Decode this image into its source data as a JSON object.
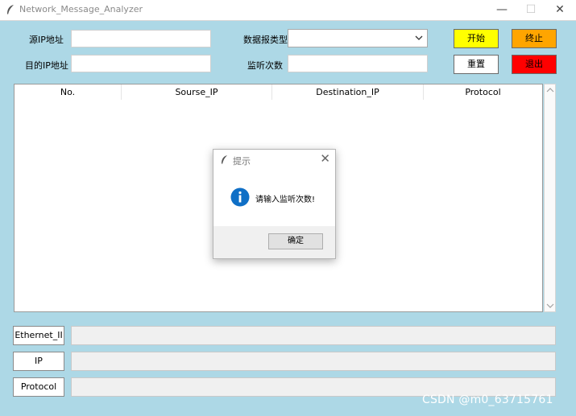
{
  "window": {
    "title": "Network_Message_Analyzer",
    "minimize_glyph": "—",
    "maximize_glyph": "☐",
    "close_glyph": "✕"
  },
  "form": {
    "src_ip_label": "源IP地址",
    "dst_ip_label": "目的IP地址",
    "packet_type_label": "数据报类型",
    "listen_count_label": "监听次数",
    "src_ip_value": "",
    "dst_ip_value": "",
    "packet_type_value": "",
    "listen_count_value": ""
  },
  "buttons": {
    "start": "开始",
    "stop": "终止",
    "reset": "重置",
    "exit": "退出"
  },
  "colors": {
    "start_bg": "#ffff00",
    "stop_bg": "#ffa500",
    "reset_bg": "#ffffff",
    "exit_bg": "#ff0000",
    "window_bg": "#add8e6",
    "info_icon": "#0f6fc6"
  },
  "table": {
    "columns": [
      "No.",
      "Sourse_IP",
      "Destination_IP",
      "Protocol"
    ],
    "rows": []
  },
  "dialog": {
    "title": "提示",
    "message": "请输入监听次数!",
    "ok_label": "确定",
    "close_glyph": "✕",
    "icon": "info-icon"
  },
  "details": {
    "ethernet_label": "Ethernet_II",
    "ip_label": "IP",
    "protocol_label": "Protocol",
    "ethernet_value": "",
    "ip_value": "",
    "protocol_value": ""
  },
  "watermark": "CSDN @m0_63715761"
}
